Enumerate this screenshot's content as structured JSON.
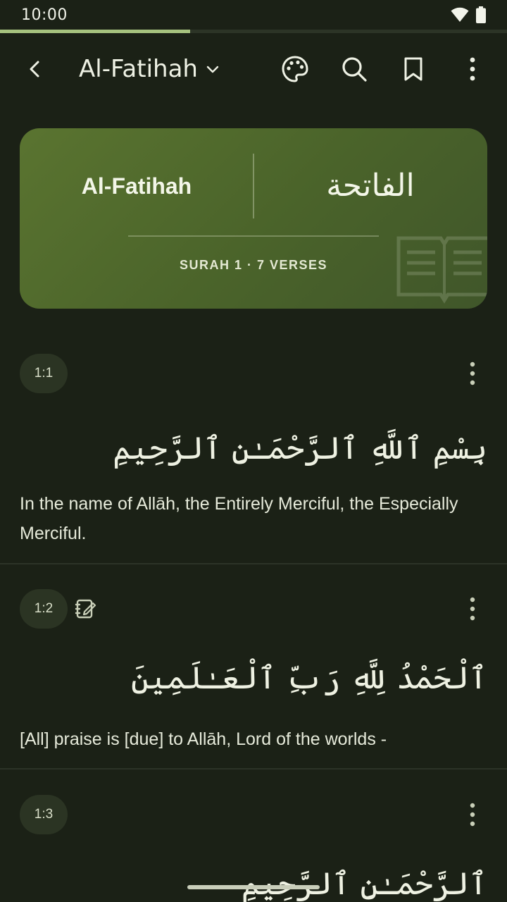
{
  "status": {
    "time": "10:00"
  },
  "reading_progress": 0.375,
  "header": {
    "title": "Al-Fatihah",
    "icons": [
      "back-icon",
      "chevron-down-icon",
      "palette-icon",
      "search-icon",
      "bookmark-icon",
      "more-vert-icon"
    ]
  },
  "surah_card": {
    "name_en": "Al-Fatihah",
    "name_ar": "الفاتحة",
    "meta": "SURAH 1 · 7 VERSES"
  },
  "verses": [
    {
      "number": "1:1",
      "arabic": "بِسْمِ ٱللَّهِ ٱلرَّحْمَـٰنِ ٱلرَّحِيمِ",
      "translation": "In the name of Allāh, the Entirely Merciful, the Especially Merciful."
    },
    {
      "number": "1:2",
      "arabic": "ٱلْحَمْدُ لِلَّهِ رَبِّ ٱلْعَـٰلَمِينَ",
      "translation": "[All] praise is [due] to Allāh, Lord of the worlds -"
    },
    {
      "number": "1:3",
      "arabic": "ٱلرَّحْمَـٰنِ ٱلرَّحِيمِ",
      "translation": ""
    }
  ],
  "colors": {
    "background": "#1b2116",
    "card": "#4f6a2c",
    "accent": "#a6c27e",
    "tajweed_blue": "#8fa3ff"
  }
}
